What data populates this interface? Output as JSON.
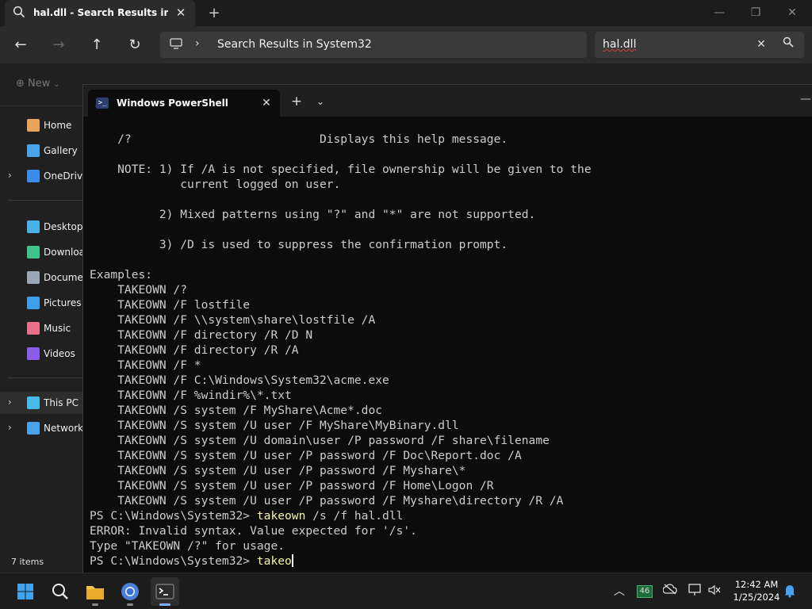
{
  "explorer": {
    "tab_title": "hal.dll - Search Results in Syste",
    "window_controls": {
      "minimize": "—",
      "maximize": "❐",
      "close": "✕"
    },
    "address_text": "Search Results in System32",
    "search_value": "hal.dll",
    "new_label": "New",
    "sidebar": [
      {
        "label": "Home",
        "icon": "home-icon",
        "color": "#e8a25a"
      },
      {
        "label": "Gallery",
        "icon": "gallery-icon",
        "color": "#4aa3e8"
      },
      {
        "label": "OneDrive",
        "icon": "cloud-icon",
        "color": "#3b8be8"
      },
      {
        "label": "Desktop",
        "icon": "desktop-icon",
        "color": "#4ab0e8"
      },
      {
        "label": "Downloads",
        "icon": "download-icon",
        "color": "#3ec48a"
      },
      {
        "label": "Documents",
        "icon": "document-icon",
        "color": "#9aa6b8"
      },
      {
        "label": "Pictures",
        "icon": "pictures-icon",
        "color": "#3e9ee8"
      },
      {
        "label": "Music",
        "icon": "music-icon",
        "color": "#e8708a"
      },
      {
        "label": "Videos",
        "icon": "videos-icon",
        "color": "#8a5ce8"
      },
      {
        "label": "This PC",
        "icon": "computer-icon",
        "color": "#4ab8e8"
      },
      {
        "label": "Network",
        "icon": "network-icon",
        "color": "#4aa3e8"
      }
    ],
    "status_text": "7 items"
  },
  "powershell": {
    "tab_title": "Windows PowerShell",
    "lines": [
      {
        "text": ""
      },
      {
        "text": "    /?                           Displays this help message."
      },
      {
        "text": ""
      },
      {
        "text": "    NOTE: 1) If /A is not specified, file ownership will be given to the"
      },
      {
        "text": "             current logged on user."
      },
      {
        "text": ""
      },
      {
        "text": "          2) Mixed patterns using \"?\" and \"*\" are not supported."
      },
      {
        "text": ""
      },
      {
        "text": "          3) /D is used to suppress the confirmation prompt."
      },
      {
        "text": ""
      },
      {
        "text": "Examples:"
      },
      {
        "text": "    TAKEOWN /?"
      },
      {
        "text": "    TAKEOWN /F lostfile"
      },
      {
        "text": "    TAKEOWN /F \\\\system\\share\\lostfile /A"
      },
      {
        "text": "    TAKEOWN /F directory /R /D N"
      },
      {
        "text": "    TAKEOWN /F directory /R /A"
      },
      {
        "text": "    TAKEOWN /F *"
      },
      {
        "text": "    TAKEOWN /F C:\\Windows\\System32\\acme.exe"
      },
      {
        "text": "    TAKEOWN /F %windir%\\*.txt"
      },
      {
        "text": "    TAKEOWN /S system /F MyShare\\Acme*.doc"
      },
      {
        "text": "    TAKEOWN /S system /U user /F MyShare\\MyBinary.dll"
      },
      {
        "text": "    TAKEOWN /S system /U domain\\user /P password /F share\\filename"
      },
      {
        "text": "    TAKEOWN /S system /U user /P password /F Doc\\Report.doc /A"
      },
      {
        "text": "    TAKEOWN /S system /U user /P password /F Myshare\\*"
      },
      {
        "text": "    TAKEOWN /S system /U user /P password /F Home\\Logon /R"
      },
      {
        "text": "    TAKEOWN /S system /U user /P password /F Myshare\\directory /R /A"
      },
      {
        "prompt": "PS C:\\Windows\\System32> ",
        "cmd": "takeown",
        "args": " /s /f hal.dll"
      },
      {
        "text": "ERROR: Invalid syntax. Value expected for '/s'."
      },
      {
        "text": "Type \"TAKEOWN /?\" for usage."
      },
      {
        "prompt": "PS C:\\Windows\\System32> ",
        "cmd": "takeo",
        "args": "",
        "cursor": true
      }
    ]
  },
  "taskbar": {
    "apps": [
      {
        "name": "start-button",
        "icon": "windows-logo-icon"
      },
      {
        "name": "search-button",
        "icon": "search-icon"
      },
      {
        "name": "file-explorer-app",
        "icon": "folder-icon"
      },
      {
        "name": "chrome-app",
        "icon": "chrome-icon"
      },
      {
        "name": "terminal-app",
        "icon": "terminal-icon"
      }
    ],
    "tray_badge": "46",
    "time": "12:42 AM",
    "date": "1/25/2024"
  }
}
